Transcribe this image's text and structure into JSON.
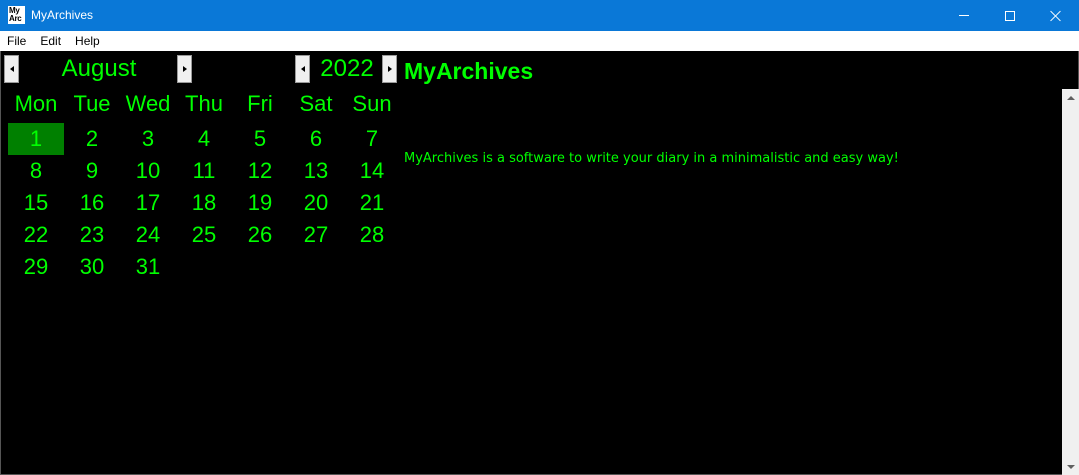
{
  "window": {
    "title": "MyArchives",
    "icon_text": "My Arc"
  },
  "menu": {
    "items": [
      "File",
      "Edit",
      "Help"
    ]
  },
  "calendar": {
    "month": "August",
    "year": "2022",
    "weekdays": [
      "Mon",
      "Tue",
      "Wed",
      "Thu",
      "Fri",
      "Sat",
      "Sun"
    ],
    "weeks": [
      [
        "1",
        "2",
        "3",
        "4",
        "5",
        "6",
        "7"
      ],
      [
        "8",
        "9",
        "10",
        "11",
        "12",
        "13",
        "14"
      ],
      [
        "15",
        "16",
        "17",
        "18",
        "19",
        "20",
        "21"
      ],
      [
        "22",
        "23",
        "24",
        "25",
        "26",
        "27",
        "28"
      ],
      [
        "29",
        "30",
        "31",
        "",
        "",
        "",
        ""
      ]
    ],
    "selected_day": "1"
  },
  "content": {
    "heading": "MyArchives",
    "description": "MyArchives is a software to write your diary in a minimalistic and easy way!"
  },
  "colors": {
    "titlebar": "#0a78d7",
    "text_green": "#00ff00",
    "selected_day_bg": "#008000",
    "background": "#000000"
  }
}
